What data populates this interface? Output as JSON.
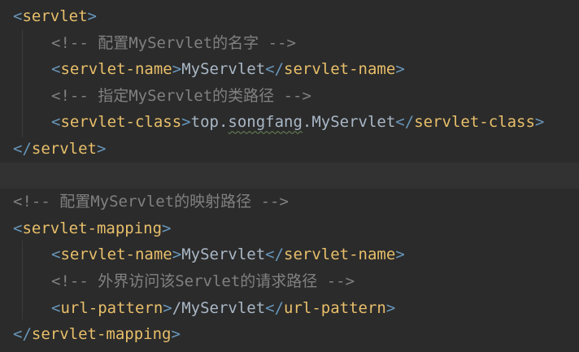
{
  "editor": {
    "lines": [
      {
        "indent": false,
        "kind": "tag",
        "open": "<",
        "name": "servlet",
        "close": ">"
      },
      {
        "indent": true,
        "kind": "comment",
        "text": "<!-- 配置MyServlet的名字 -->"
      },
      {
        "indent": true,
        "kind": "element",
        "tag": "servlet-name",
        "value": "MyServlet"
      },
      {
        "indent": true,
        "kind": "comment",
        "text": "<!-- 指定MyServlet的类路径 -->"
      },
      {
        "indent": true,
        "kind": "element-squiggle",
        "tag": "servlet-class",
        "value_pre": "top.",
        "value_squiggle": "songfang",
        "value_post": ".MyServlet"
      },
      {
        "indent": false,
        "kind": "tag",
        "open": "</",
        "name": "servlet",
        "close": ">"
      },
      {
        "indent": false,
        "kind": "blank",
        "current": true
      },
      {
        "indent": false,
        "kind": "comment",
        "text": "<!-- 配置MyServlet的映射路径 -->"
      },
      {
        "indent": false,
        "kind": "tag",
        "open": "<",
        "name": "servlet-mapping",
        "close": ">"
      },
      {
        "indent": true,
        "kind": "element",
        "tag": "servlet-name",
        "value": "MyServlet"
      },
      {
        "indent": true,
        "kind": "comment",
        "text": "<!-- 外界访问该Servlet的请求路径 -->"
      },
      {
        "indent": true,
        "kind": "element",
        "tag": "url-pattern",
        "value": "/MyServlet"
      },
      {
        "indent": false,
        "kind": "tag",
        "open": "</",
        "name": "servlet-mapping",
        "close": ">"
      }
    ]
  },
  "colors": {
    "background": "#2b2b2b",
    "current_line": "#323232",
    "tag": "#e8bf6a",
    "comment": "#808080",
    "text": "#a9b7c6",
    "bracket": "#6897bb"
  }
}
